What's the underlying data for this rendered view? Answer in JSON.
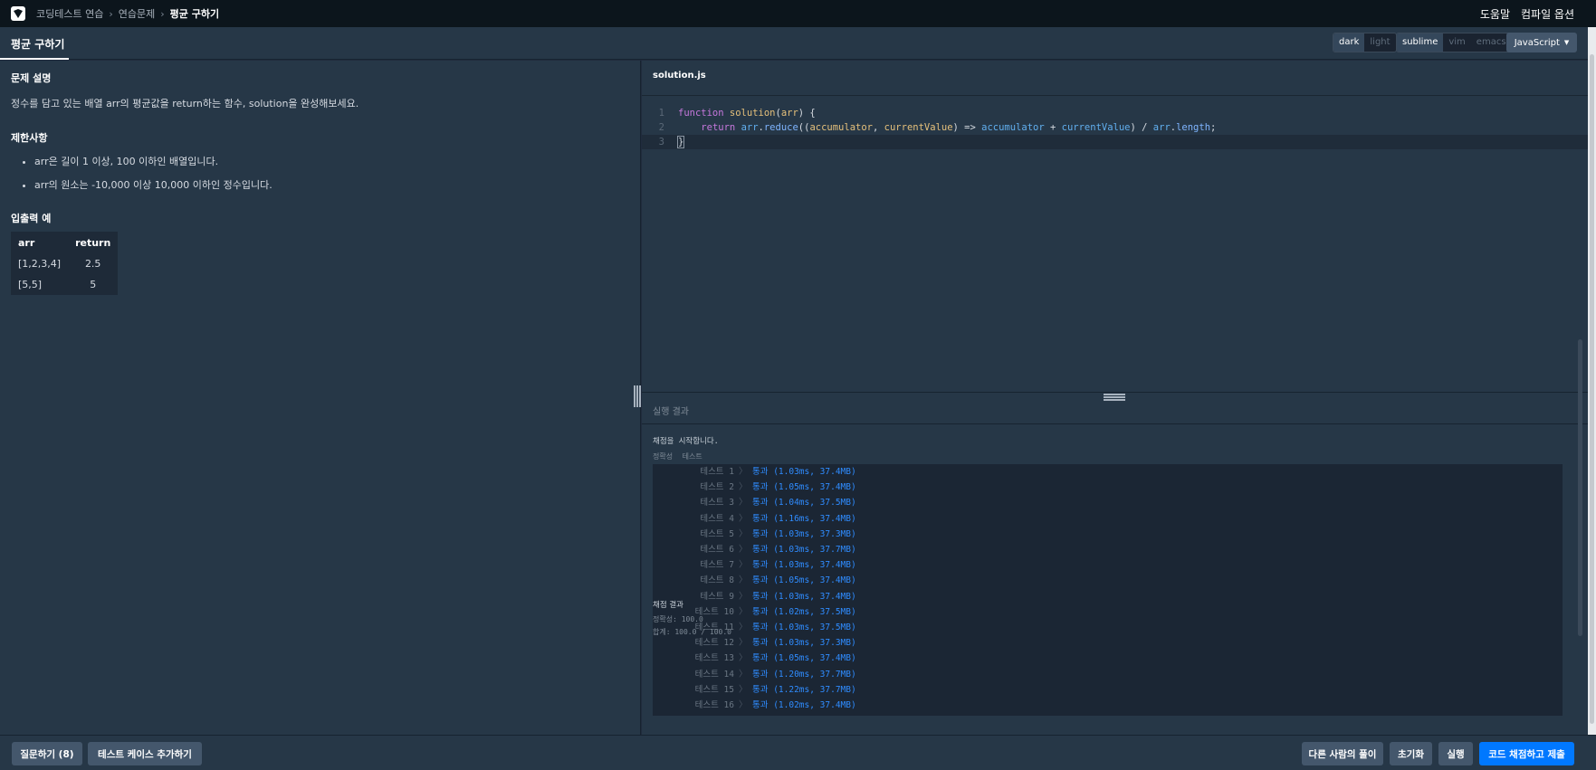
{
  "breadcrumb": {
    "items": [
      "코딩테스트 연습",
      "연습문제",
      "평균 구하기"
    ]
  },
  "topnav": {
    "help": "도움말",
    "compile_options": "컴파일 옵션"
  },
  "lesson": {
    "title": "평균 구하기"
  },
  "options": {
    "theme": [
      "dark",
      "light"
    ],
    "keymap": [
      "sublime",
      "vim",
      "emacs"
    ],
    "language": "JavaScript"
  },
  "problem": {
    "desc_heading": "문제 설명",
    "description": "정수를 담고 있는 배열 arr의 평균값을 return하는 함수, solution을 완성해보세요.",
    "constraints_heading": "제한사항",
    "constraints": [
      "arr은 길이 1 이상, 100 이하인 배열입니다.",
      "arr의 원소는 -10,000 이상 10,000 이하인 정수입니다."
    ],
    "examples_heading": "입출력 예",
    "examples": {
      "headers": [
        "arr",
        "return"
      ],
      "rows": [
        [
          "[1,2,3,4]",
          "2.5"
        ],
        [
          "[5,5]",
          "5"
        ]
      ]
    }
  },
  "editor": {
    "filename": "solution.js",
    "line_numbers": [
      "1",
      "2",
      "3"
    ]
  },
  "results": {
    "heading": "실행 결과",
    "start_msg": "채점을 시작합니다.",
    "tabs": [
      "정확성",
      "테스트"
    ],
    "tests": [
      {
        "name": "테스트 1",
        "result": "통과 (1.03ms, 37.4MB)"
      },
      {
        "name": "테스트 2",
        "result": "통과 (1.05ms, 37.4MB)"
      },
      {
        "name": "테스트 3",
        "result": "통과 (1.04ms, 37.5MB)"
      },
      {
        "name": "테스트 4",
        "result": "통과 (1.16ms, 37.4MB)"
      },
      {
        "name": "테스트 5",
        "result": "통과 (1.03ms, 37.3MB)"
      },
      {
        "name": "테스트 6",
        "result": "통과 (1.03ms, 37.7MB)"
      },
      {
        "name": "테스트 7",
        "result": "통과 (1.03ms, 37.4MB)"
      },
      {
        "name": "테스트 8",
        "result": "통과 (1.05ms, 37.4MB)"
      },
      {
        "name": "테스트 9",
        "result": "통과 (1.03ms, 37.4MB)"
      },
      {
        "name": "테스트 10",
        "result": "통과 (1.02ms, 37.5MB)"
      },
      {
        "name": "테스트 11",
        "result": "통과 (1.03ms, 37.5MB)"
      },
      {
        "name": "테스트 12",
        "result": "통과 (1.03ms, 37.3MB)"
      },
      {
        "name": "테스트 13",
        "result": "통과 (1.05ms, 37.4MB)"
      },
      {
        "name": "테스트 14",
        "result": "통과 (1.20ms, 37.7MB)"
      },
      {
        "name": "테스트 15",
        "result": "통과 (1.22ms, 37.7MB)"
      },
      {
        "name": "테스트 16",
        "result": "통과 (1.02ms, 37.4MB)"
      }
    ],
    "grade_heading": "채점 결과",
    "accuracy": "정확성: 100.0",
    "total": "합계: 100.0 / 100.0"
  },
  "footer": {
    "ask": "질문하기 (8)",
    "add_testcase": "테스트 케이스 추가하기",
    "others_solution": "다른 사람의 풀이",
    "reset": "초기화",
    "run": "실행",
    "submit": "코드 채점하고 제출"
  },
  "colors": {
    "accent": "#0078ff",
    "pass": "#2f8cff",
    "bg": "#263747"
  }
}
